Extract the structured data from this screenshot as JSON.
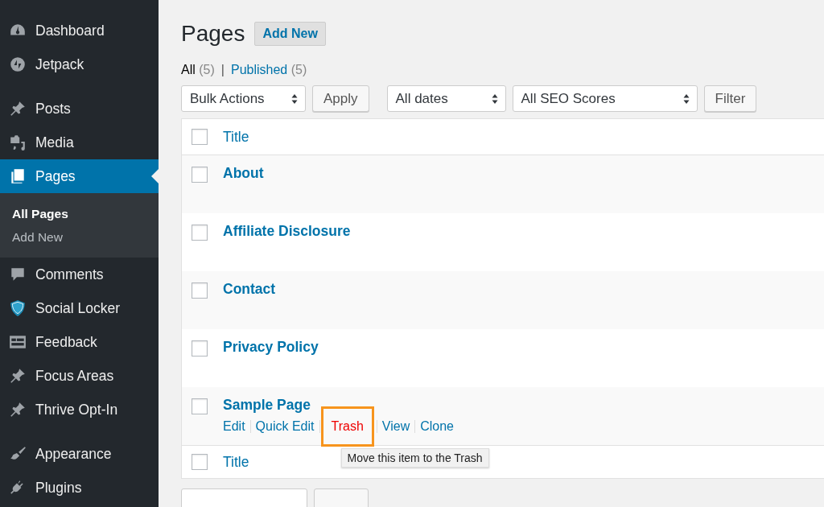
{
  "sidebar": {
    "groups": [
      [
        {
          "label": "Dashboard",
          "selected": false
        },
        {
          "label": "Jetpack",
          "selected": false
        }
      ],
      [
        {
          "label": "Posts",
          "selected": false
        },
        {
          "label": "Media",
          "selected": false
        },
        {
          "label": "Pages",
          "selected": true,
          "children": [
            {
              "label": "All Pages",
              "selected": true
            },
            {
              "label": "Add New",
              "selected": false
            }
          ]
        },
        {
          "label": "Comments",
          "selected": false
        },
        {
          "label": "Social Locker",
          "selected": false
        },
        {
          "label": "Feedback",
          "selected": false
        },
        {
          "label": "Focus Areas",
          "selected": false
        },
        {
          "label": "Thrive Opt-In",
          "selected": false
        }
      ],
      [
        {
          "label": "Appearance",
          "selected": false
        },
        {
          "label": "Plugins",
          "selected": false
        }
      ]
    ]
  },
  "page": {
    "title": "Pages",
    "add_button": "Add New"
  },
  "views": [
    {
      "label": "All",
      "count": "(5)",
      "selected": true
    },
    {
      "label": "Published",
      "count": "(5)",
      "selected": false
    }
  ],
  "view_separator": "|",
  "toolbar": [
    {
      "kind": "select",
      "label": "Bulk Actions"
    },
    {
      "kind": "button",
      "label": "Apply"
    },
    {
      "kind": "select",
      "label": "All dates"
    },
    {
      "kind": "select",
      "label": "All SEO Scores"
    },
    {
      "kind": "button",
      "label": "Filter"
    }
  ],
  "table": {
    "header_title": "Title",
    "header_checked": false,
    "footer_title": "Title",
    "footer_checked": false,
    "rows": [
      {
        "title": "About",
        "checked": false
      },
      {
        "title": "Affiliate Disclosure",
        "checked": false
      },
      {
        "title": "Contact",
        "checked": false
      },
      {
        "title": "Privacy Policy",
        "checked": false
      },
      {
        "title": "Sample Page",
        "checked": false,
        "actions": [
          {
            "label": "Edit",
            "kind": "link",
            "highlighted": false
          },
          {
            "label": "Quick Edit",
            "kind": "link",
            "highlighted": false
          },
          {
            "label": "Trash",
            "kind": "delete",
            "highlighted": true,
            "tooltip": "Move this item to the Trash"
          },
          {
            "label": "View",
            "kind": "link",
            "highlighted": false
          },
          {
            "label": "Clone",
            "kind": "link",
            "highlighted": false
          }
        ]
      }
    ]
  }
}
